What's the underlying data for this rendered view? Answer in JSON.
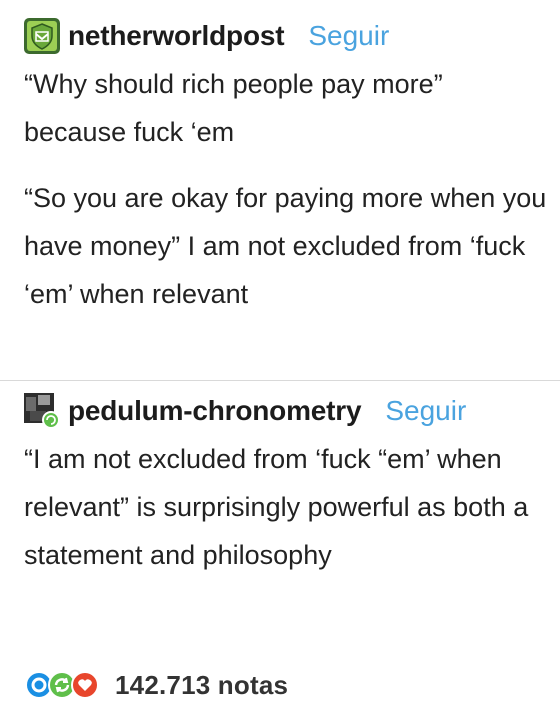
{
  "posts": [
    {
      "username": "netherworldpost",
      "follow_label": "Seguir",
      "paragraphs": [
        "“Why should rich people pay more” because fuck ‘em",
        "“So you are okay for paying more when you have money” I am not excluded from ‘fuck ‘em’ when relevant"
      ],
      "avatar_icon": "green-shield-avatar-icon"
    },
    {
      "username": "pedulum-chronometry",
      "follow_label": "Seguir",
      "paragraphs": [
        "“I am not excluded from ‘fuck “em’ when relevant” is surprisingly powerful as both a statement and philosophy"
      ],
      "avatar_icon": "dark-photo-avatar-icon"
    }
  ],
  "notes": {
    "count_label": "142.713 notas",
    "icons": [
      "reply-icon",
      "reblog-icon",
      "like-icon"
    ]
  },
  "colors": {
    "link": "#4aa3df",
    "reply": "#1a8fe3",
    "reblog": "#5fbf4a",
    "like": "#e8462c"
  }
}
